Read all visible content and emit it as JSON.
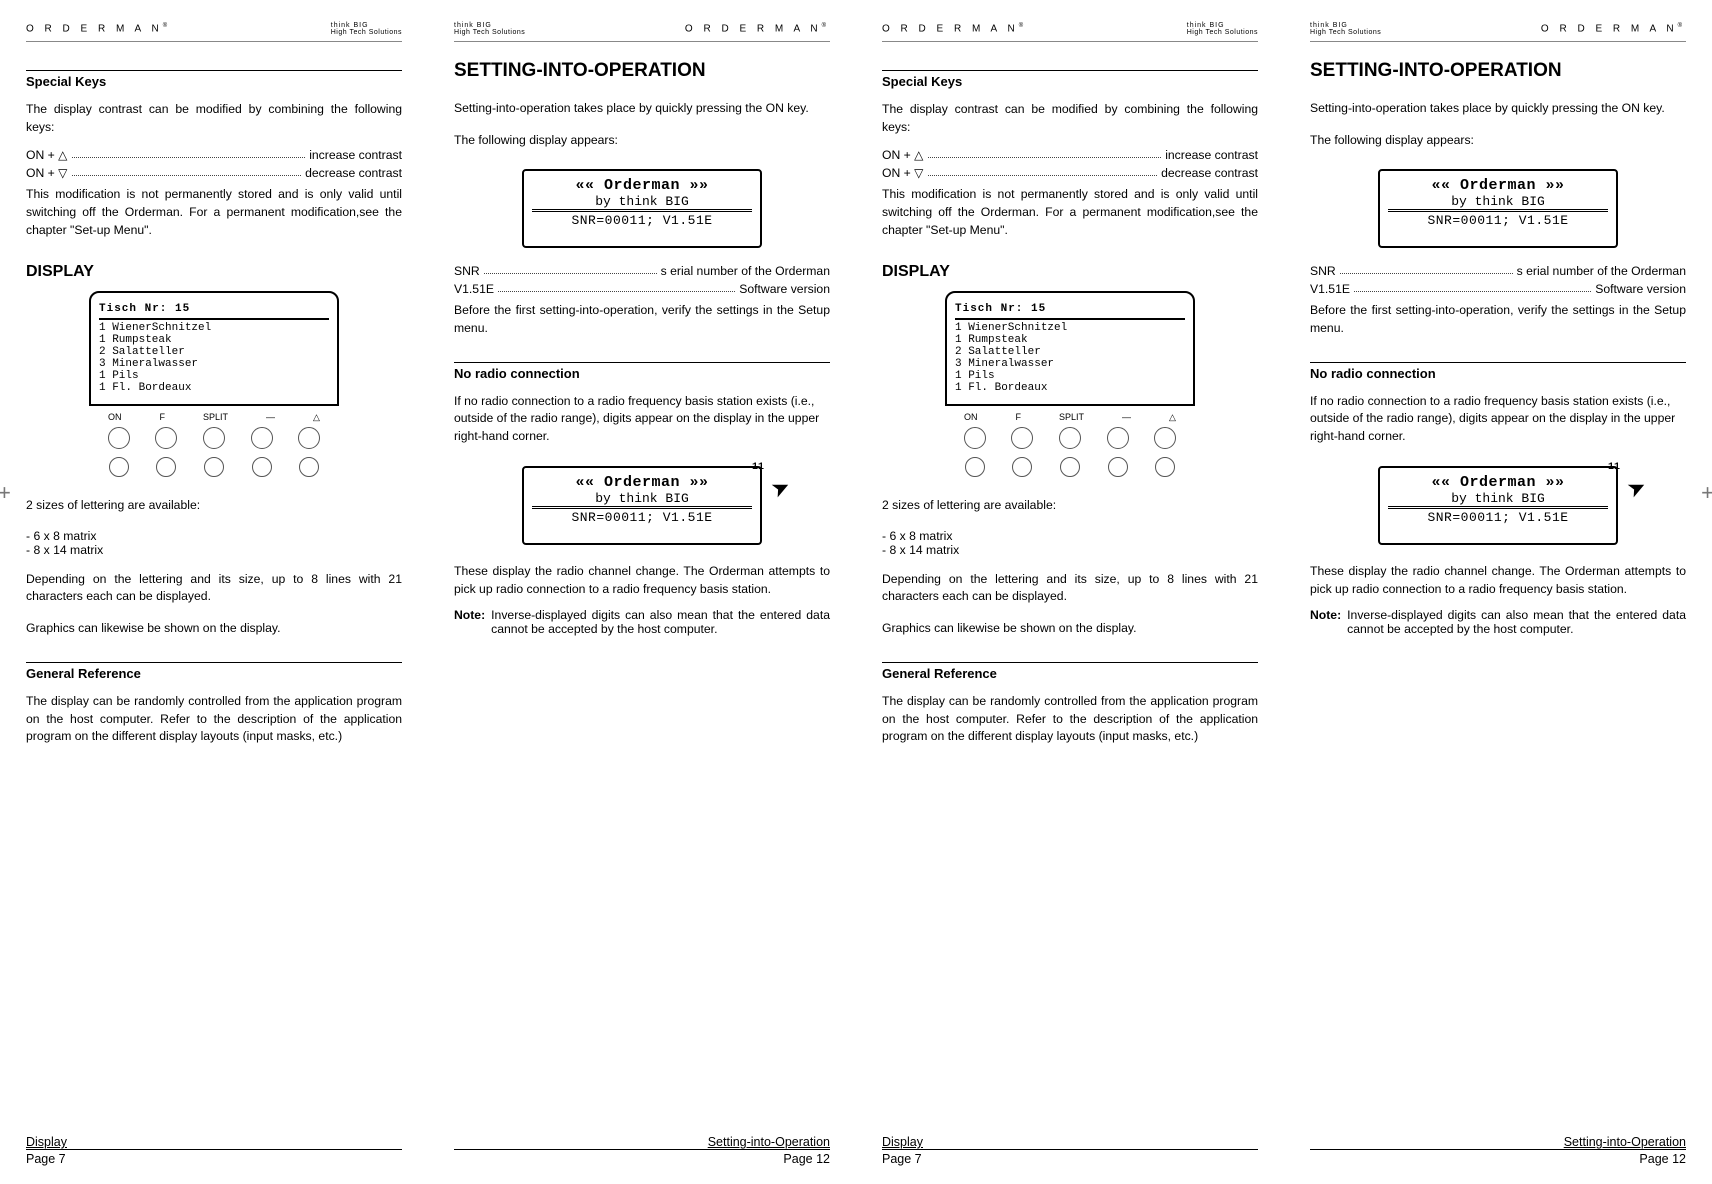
{
  "brand": "O R D E R M A N",
  "brand_sup": "®",
  "tagline": "think BIG",
  "tagline2": "High Tech Solutions",
  "p7": {
    "h_special": "Special Keys",
    "para_contrast": "The display contrast can be modified by combining the following keys:",
    "row_inc_l": "ON + △",
    "row_inc_r": "increase contrast",
    "row_dec_l": "ON + ▽",
    "row_dec_r": "decrease contrast",
    "para_perm": "This modification is not permanently stored and is only valid until switching off the Orderman. For a permanent modification,see the chapter \"Set-up Menu\".",
    "h_display": "DISPLAY",
    "screen_title": "Tisch Nr: 15",
    "screen_lines": "1 WienerSchnitzel\n1 Rumpsteak\n2 Salatteller\n3 Mineralwasser\n1 Pils\n1 Fl. Bordeaux",
    "btns": [
      "ON",
      "F",
      "SPLIT",
      "—",
      "△"
    ],
    "para_sizes": "2 sizes of lettering are available:",
    "size1": "6 x 8 matrix",
    "size2": "8 x 14 matrix",
    "para_lines": "Depending on the lettering and its size, up to 8 lines with 21 characters each can be displayed.",
    "para_gfx": "Graphics can likewise be shown on the display.",
    "h_general": "General Reference",
    "para_general": "The display can be randomly controlled from the application program on the host computer. Refer to the description of the application program on the different display layouts (input masks, etc.)",
    "foot_l": "Display",
    "foot_r": "Page 7"
  },
  "p12": {
    "title": "SETTING-INTO-OPERATION",
    "para1": "Setting-into-operation takes place by quickly pressing the ON key.",
    "para2": "The following display appears:",
    "lcd_l1": "«« Orderman »»",
    "lcd_l2": "by think BIG",
    "lcd_l3": "SNR=00011; V1.51E",
    "row_snr_l": "SNR",
    "row_snr_r": "s erial number of the Orderman",
    "row_ver_l": "V1.51E",
    "row_ver_r": "Software version",
    "para_before": "Before the first setting-into-operation, verify the settings in the Setup menu.",
    "h_noradio": "No radio connection",
    "para_noradio": "If no radio connection to a radio frequency basis station exists (i.e., outside of the radio range), digits appear on the display in the upper right-hand corner.",
    "corner": "11",
    "para_change": "These display the radio channel change. The Orderman attempts to pick up radio connection to a radio frequency basis station.",
    "note_label": "Note:",
    "note_text": "Inverse-displayed digits can also mean that the entered data cannot be accepted by the host computer.",
    "foot_l": "Setting-into-Operation",
    "foot_r": "Page 12"
  }
}
